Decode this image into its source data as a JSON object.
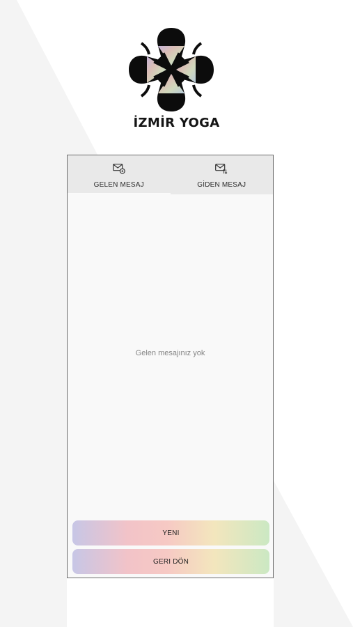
{
  "brand": {
    "name": "İZMİR YOGA",
    "logo_icon": "yoga-lotus-logo-icon"
  },
  "tabs": [
    {
      "label": "GELEN MESAJ",
      "icon": "mail-inbox-icon",
      "active": true
    },
    {
      "label": "GİDEN MESAJ",
      "icon": "mail-outbox-icon",
      "active": false
    }
  ],
  "messages": {
    "empty_text": "Gelen mesajınız yok"
  },
  "buttons": {
    "new_label": "YENI",
    "back_label": "GERI DÖN"
  },
  "colors": {
    "button_gradient": [
      "#c7c6e6",
      "#f2c3c8",
      "#f6c9c4",
      "#f3e6bd",
      "#cbe8c3"
    ],
    "panel_bg": "#f9f9f9",
    "tab_bg": "#e9e9e9"
  }
}
